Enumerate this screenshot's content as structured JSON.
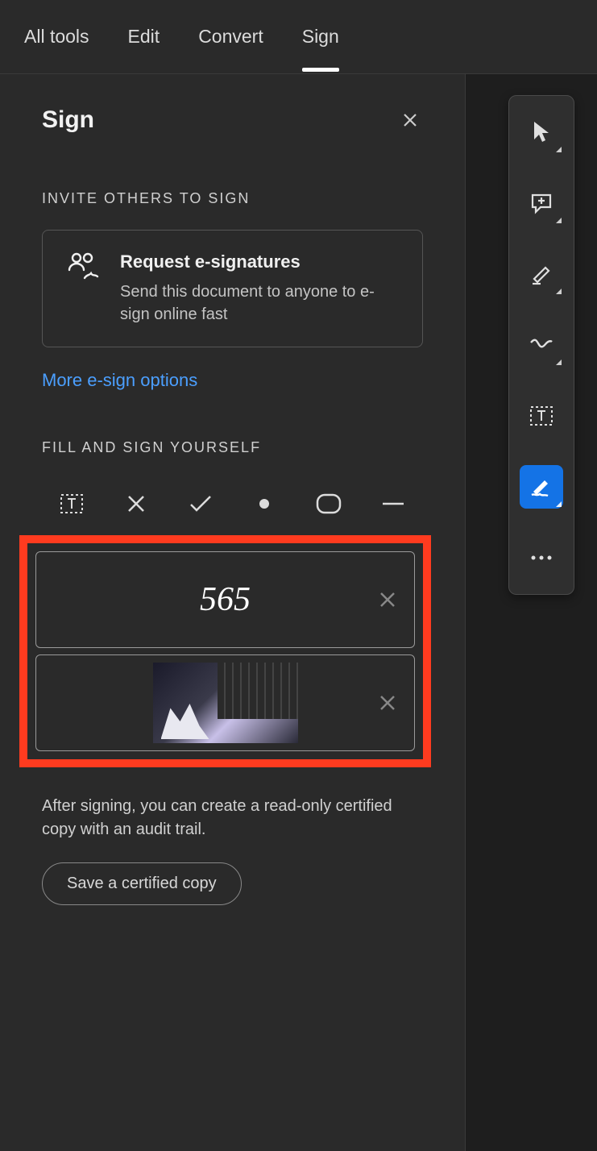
{
  "tabs": {
    "all_tools": "All tools",
    "edit": "Edit",
    "convert": "Convert",
    "sign": "Sign"
  },
  "panel": {
    "title": "Sign",
    "invite_label": "INVITE OTHERS TO SIGN",
    "request": {
      "title": "Request e-signatures",
      "desc": "Send this document to anyone to e-sign online fast"
    },
    "more_link": "More e-sign options",
    "fill_label": "FILL AND SIGN YOURSELF",
    "signature_text": "565",
    "note": "After signing, you can create a read-only certified copy with an audit trail.",
    "save_btn": "Save a certified copy"
  }
}
